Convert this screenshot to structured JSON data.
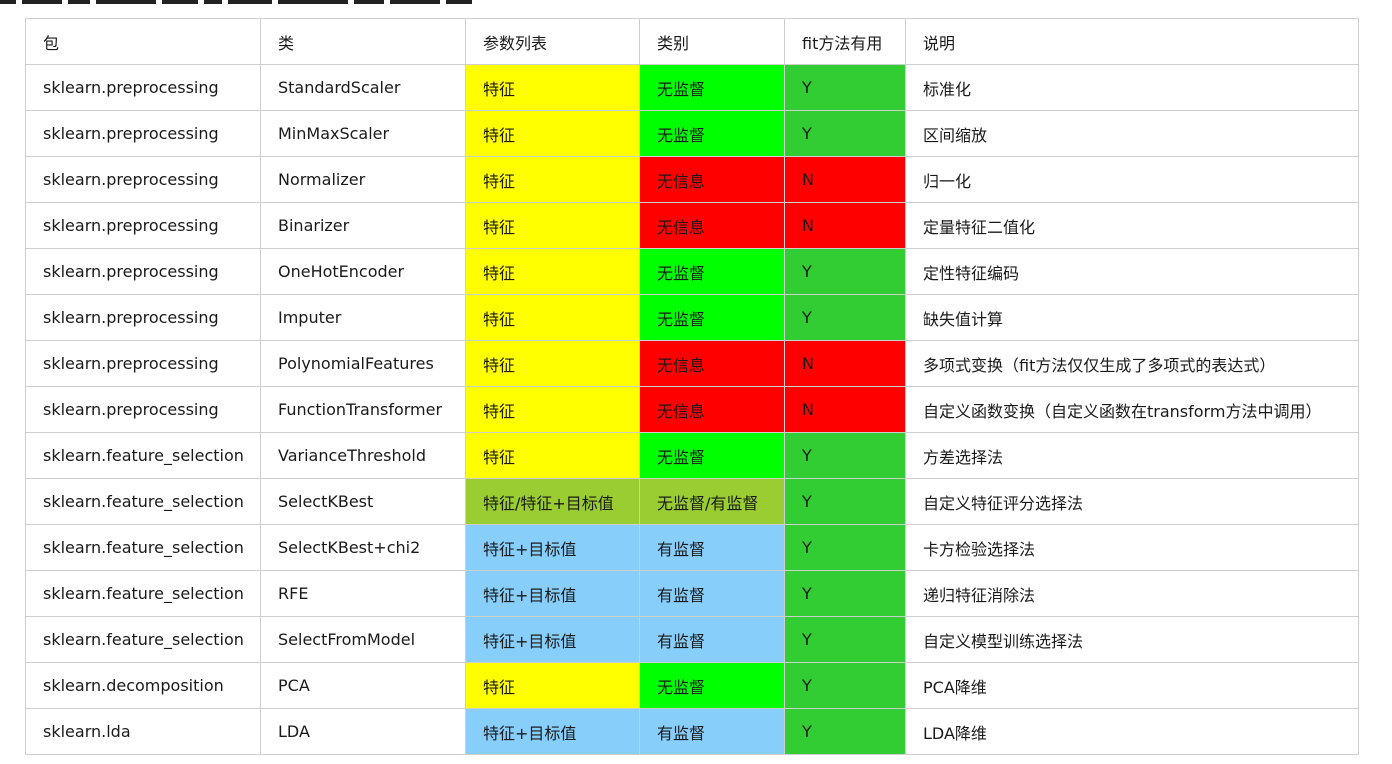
{
  "colors": {
    "yellow": "#ffff00",
    "green": "#00ff00",
    "red": "#ff0000",
    "fit_green": "#32cd32",
    "olive": "#9acd32",
    "blue": "#87cefa",
    "border": "#cfcfcf"
  },
  "table": {
    "headers": [
      "包",
      "类",
      "参数列表",
      "类别",
      "fit方法有用",
      "说明"
    ],
    "rows": [
      {
        "package": "sklearn.preprocessing",
        "class": "StandardScaler",
        "params": "特征",
        "kind": "无监督",
        "fit": "Y",
        "desc": "标准化",
        "params_color": "yellow",
        "kind_color": "green",
        "fit_color": "fit_green"
      },
      {
        "package": "sklearn.preprocessing",
        "class": "MinMaxScaler",
        "params": "特征",
        "kind": "无监督",
        "fit": "Y",
        "desc": "区间缩放",
        "params_color": "yellow",
        "kind_color": "green",
        "fit_color": "fit_green"
      },
      {
        "package": "sklearn.preprocessing",
        "class": "Normalizer",
        "params": "特征",
        "kind": "无信息",
        "fit": "N",
        "desc": "归一化",
        "params_color": "yellow",
        "kind_color": "red",
        "fit_color": "red"
      },
      {
        "package": "sklearn.preprocessing",
        "class": "Binarizer",
        "params": "特征",
        "kind": "无信息",
        "fit": "N",
        "desc": "定量特征二值化",
        "params_color": "yellow",
        "kind_color": "red",
        "fit_color": "red"
      },
      {
        "package": "sklearn.preprocessing",
        "class": "OneHotEncoder",
        "params": "特征",
        "kind": "无监督",
        "fit": "Y",
        "desc": "定性特征编码",
        "params_color": "yellow",
        "kind_color": "green",
        "fit_color": "fit_green"
      },
      {
        "package": "sklearn.preprocessing",
        "class": "Imputer",
        "params": "特征",
        "kind": "无监督",
        "fit": "Y",
        "desc": "缺失值计算",
        "params_color": "yellow",
        "kind_color": "green",
        "fit_color": "fit_green"
      },
      {
        "package": "sklearn.preprocessing",
        "class": "PolynomialFeatures",
        "params": "特征",
        "kind": "无信息",
        "fit": "N",
        "desc": "多项式变换（fit方法仅仅生成了多项式的表达式）",
        "params_color": "yellow",
        "kind_color": "red",
        "fit_color": "red"
      },
      {
        "package": "sklearn.preprocessing",
        "class": "FunctionTransformer",
        "params": "特征",
        "kind": "无信息",
        "fit": "N",
        "desc": "自定义函数变换（自定义函数在transform方法中调用）",
        "params_color": "yellow",
        "kind_color": "red",
        "fit_color": "red"
      },
      {
        "package": "sklearn.feature_selection",
        "class": "VarianceThreshold",
        "params": "特征",
        "kind": "无监督",
        "fit": "Y",
        "desc": "方差选择法",
        "params_color": "yellow",
        "kind_color": "green",
        "fit_color": "fit_green"
      },
      {
        "package": "sklearn.feature_selection",
        "class": "SelectKBest",
        "params": "特征/特征+目标值",
        "kind": "无监督/有监督",
        "fit": "Y",
        "desc": "自定义特征评分选择法",
        "params_color": "olive",
        "kind_color": "olive",
        "fit_color": "fit_green"
      },
      {
        "package": "sklearn.feature_selection",
        "class": "SelectKBest+chi2",
        "params": "特征+目标值",
        "kind": "有监督",
        "fit": "Y",
        "desc": "卡方检验选择法",
        "params_color": "blue",
        "kind_color": "blue",
        "fit_color": "fit_green"
      },
      {
        "package": "sklearn.feature_selection",
        "class": "RFE",
        "params": "特征+目标值",
        "kind": "有监督",
        "fit": "Y",
        "desc": "递归特征消除法",
        "params_color": "blue",
        "kind_color": "blue",
        "fit_color": "fit_green"
      },
      {
        "package": "sklearn.feature_selection",
        "class": "SelectFromModel",
        "params": "特征+目标值",
        "kind": "有监督",
        "fit": "Y",
        "desc": "自定义模型训练选择法",
        "params_color": "blue",
        "kind_color": "blue",
        "fit_color": "fit_green"
      },
      {
        "package": "sklearn.decomposition",
        "class": "PCA",
        "params": "特征",
        "kind": "无监督",
        "fit": "Y",
        "desc": "PCA降维",
        "params_color": "yellow",
        "kind_color": "green",
        "fit_color": "fit_green"
      },
      {
        "package": "sklearn.lda",
        "class": "LDA",
        "params": "特征+目标值",
        "kind": "有监督",
        "fit": "Y",
        "desc": "LDA降维",
        "params_color": "blue",
        "kind_color": "blue",
        "fit_color": "fit_green"
      }
    ]
  }
}
